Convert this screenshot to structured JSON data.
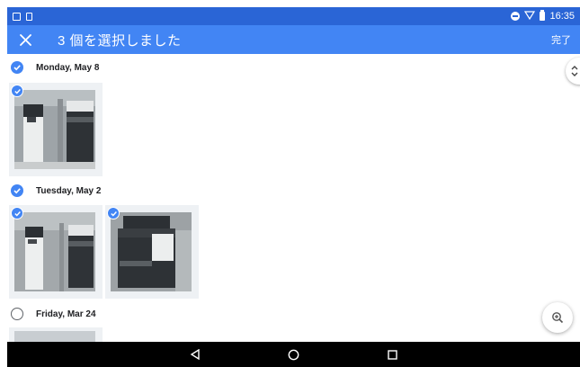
{
  "status_bar": {
    "time": "16:35",
    "icons": [
      "photo-icon",
      "sim-icon",
      "do-not-disturb-icon",
      "wifi-icon",
      "battery-icon"
    ]
  },
  "app_bar": {
    "title": "3 個を選択しました",
    "done_label": "完了",
    "close_icon": "close-icon"
  },
  "sections": [
    {
      "date": "Monday, May 8",
      "selected": true,
      "photos": [
        {
          "selected": true
        }
      ]
    },
    {
      "date": "Tuesday, May 2",
      "selected": true,
      "photos": [
        {
          "selected": true
        },
        {
          "selected": true
        }
      ]
    },
    {
      "date": "Friday, Mar 24",
      "selected": false,
      "photos": [
        {
          "selected": false
        }
      ]
    }
  ],
  "colors": {
    "status_bar": "#2a65d6",
    "app_bar": "#4285f4",
    "check": "#4285f4",
    "nav_bar": "#000000"
  },
  "nav": [
    "back-icon",
    "home-icon",
    "recents-icon"
  ]
}
